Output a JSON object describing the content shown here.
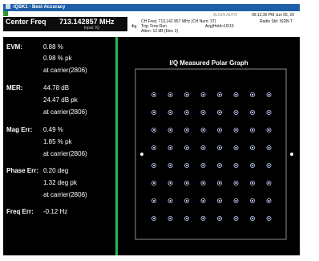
{
  "window": {
    "title": "IQSK1 - Best Accuracy"
  },
  "header": {
    "center_freq_label": "Center Freq",
    "center_freq_value": "713.142857 MHz",
    "input_label": "Input: IQ",
    "trig": "Trig: Free Run",
    "atten": "Atten: 12 dB (Elec 2)",
    "cf_line": "CH Freq: 713.142 857 MHz (CH Num: 37)",
    "avg": "Avg|Hold>10/10",
    "align": "ALIGN AUTO",
    "datetime": "09:12:30 PM Jun 05, 20",
    "radio": "Radio Std: ISDB-T"
  },
  "metrics": [
    {
      "label": "EVM:",
      "rows": [
        "0.88 %",
        "0.98 % pk",
        "at carrier(2806)"
      ]
    },
    {
      "label": "MER:",
      "rows": [
        "44.78 dB",
        "24.47 dB pk",
        "at carrier(2806)"
      ]
    },
    {
      "label": "Mag Err:",
      "rows": [
        "0.49 %",
        "1.85 % pk",
        "at carrier(2806)"
      ]
    },
    {
      "label": "Phase Err:",
      "rows": [
        "0.20 deg",
        "1.32 deg pk",
        "at carrier(2806)"
      ]
    },
    {
      "label": "Freq Err:",
      "rows": [
        "-0.12 Hz"
      ]
    }
  ],
  "graph": {
    "title": "I/Q Measured Polar Graph",
    "constellation": "64QAM",
    "colors": {
      "grid": "#8c8c8c",
      "symbol": "#b4c9ff",
      "divider": "#2fb44a"
    }
  }
}
